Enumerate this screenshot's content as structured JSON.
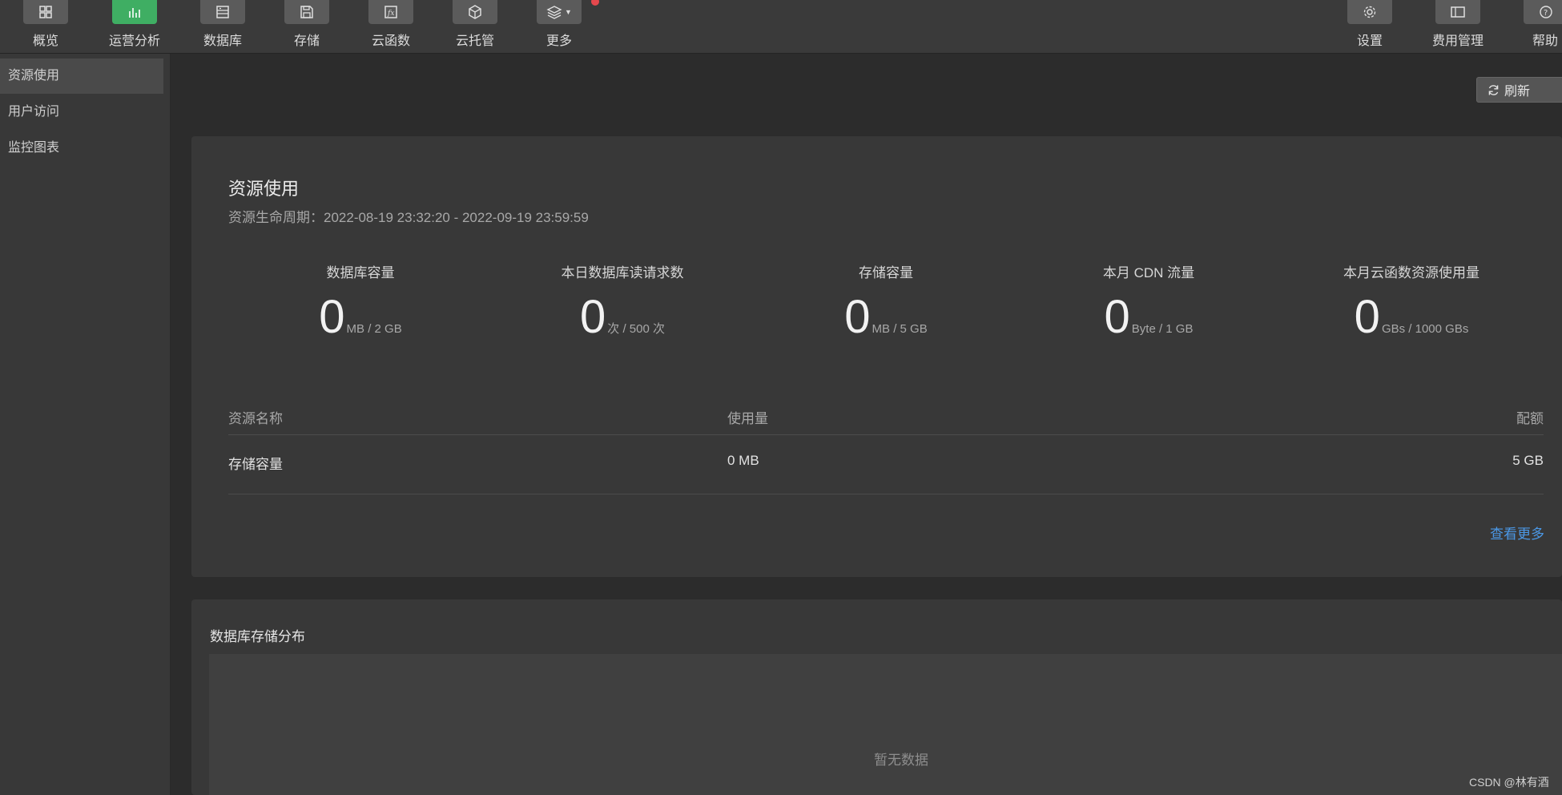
{
  "toolbar": {
    "items": [
      {
        "label": "概览",
        "icon": "grid-icon"
      },
      {
        "label": "运营分析",
        "icon": "bar-chart-icon",
        "active": true
      },
      {
        "label": "数据库",
        "icon": "database-icon"
      },
      {
        "label": "存储",
        "icon": "save-icon"
      },
      {
        "label": "云函数",
        "icon": "function-icon"
      },
      {
        "label": "云托管",
        "icon": "cube-icon"
      },
      {
        "label": "更多",
        "icon": "layers-icon"
      }
    ],
    "right_items": [
      {
        "label": "设置",
        "icon": "gear-icon"
      },
      {
        "label": "费用管理",
        "icon": "billing-icon"
      },
      {
        "label": "帮助",
        "icon": "help-icon"
      }
    ]
  },
  "sidebar": {
    "items": [
      {
        "label": "资源使用",
        "active": true
      },
      {
        "label": "用户访问"
      },
      {
        "label": "监控图表"
      }
    ]
  },
  "main": {
    "refresh_label": "刷新",
    "resource_card": {
      "title": "资源使用",
      "lifecycle": "资源生命周期：2022-08-19 23:32:20 - 2022-09-19 23:59:59",
      "metrics": [
        {
          "label": "数据库容量",
          "value": "0",
          "unit": "MB / 2 GB"
        },
        {
          "label": "本日数据库读请求数",
          "value": "0",
          "unit": "次 / 500 次"
        },
        {
          "label": "存储容量",
          "value": "0",
          "unit": "MB / 5 GB"
        },
        {
          "label": "本月 CDN 流量",
          "value": "0",
          "unit": "Byte / 1 GB"
        },
        {
          "label": "本月云函数资源使用量",
          "value": "0",
          "unit": "GBs / 1000 GBs"
        }
      ],
      "table": {
        "headers": [
          "资源名称",
          "使用量",
          "配额"
        ],
        "rows": [
          [
            "存储容量",
            "0 MB",
            "5 GB"
          ]
        ]
      },
      "more_link": "查看更多"
    },
    "db_card": {
      "title": "数据库存储分布",
      "empty": "暂无数据"
    }
  },
  "watermark": "CSDN @林有酒",
  "colors": {
    "accent_active": "#3fae63",
    "link": "#4b98e6",
    "notification_dot": "#e5484d"
  }
}
